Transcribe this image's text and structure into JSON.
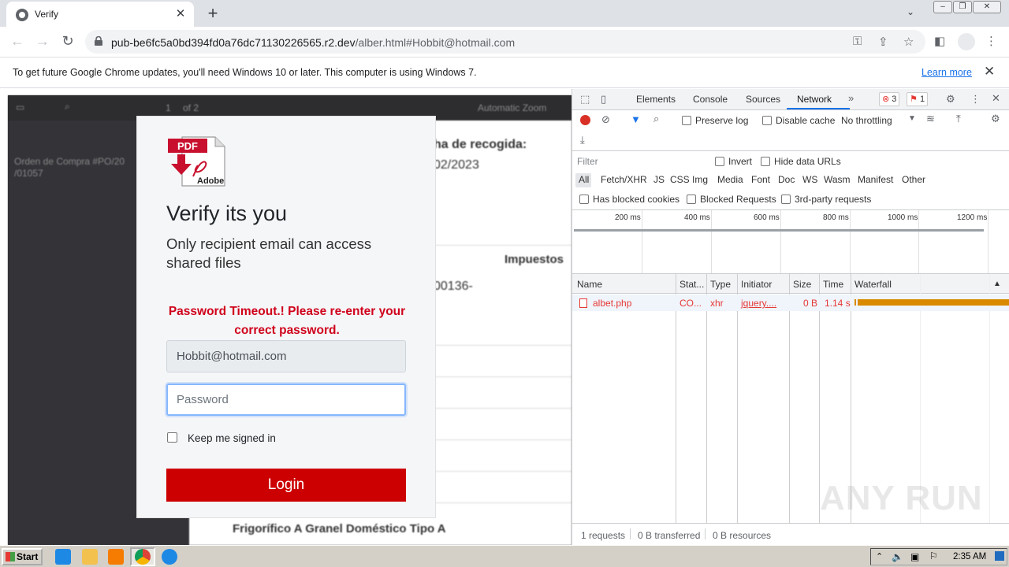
{
  "browser": {
    "tab_title": "Verify",
    "url_host": "pub-be6fc5a0bd394fd0a76dc71130226565.r2.dev",
    "url_path": "/alber.html#Hobbit@hotmail.com",
    "infobar_message": "To get future Google Chrome updates, you'll need Windows 10 or later. This computer is using Windows 7.",
    "infobar_link": "Learn more"
  },
  "pdf_background": {
    "sidebar_text_1": "Orden de Compra #PO/20",
    "sidebar_text_2": "/01057",
    "toolbar_page": "1",
    "toolbar_of": "of 2",
    "toolbar_zoom": "Automatic Zoom",
    "doc_text_1": "ha de recogida:",
    "doc_text_2": "02/2023",
    "doc_text_3": "Impuestos",
    "doc_text_4": "00136-",
    "doc_text_5": "Frigorífico A Granel Doméstico Tipo A"
  },
  "modal": {
    "logo_pdf": "PDF",
    "logo_brand": "Adobe",
    "title": "Verify its you",
    "subtitle": "Only recipient email can access shared files",
    "error": "Password Timeout.! Please re-enter your correct password.",
    "email_value": "Hobbit@hotmail.com",
    "password_placeholder": "Password",
    "keep_signed_in": "Keep me signed in",
    "login_label": "Login"
  },
  "devtools": {
    "tabs": [
      "Elements",
      "Console",
      "Sources",
      "Network"
    ],
    "active_tab": "Network",
    "error_count": "3",
    "issue_count": "1",
    "preserve_log": "Preserve log",
    "disable_cache": "Disable cache",
    "throttling": "No throttling",
    "filter_placeholder": "Filter",
    "invert": "Invert",
    "hide_data_urls": "Hide data URLs",
    "type_filters": [
      "All",
      "Fetch/XHR",
      "JS",
      "CSS",
      "Img",
      "Media",
      "Font",
      "Doc",
      "WS",
      "Wasm",
      "Manifest",
      "Other"
    ],
    "has_blocked_cookies": "Has blocked cookies",
    "blocked_requests": "Blocked Requests",
    "third_party": "3rd-party requests",
    "timeline_ticks": [
      "200 ms",
      "400 ms",
      "600 ms",
      "800 ms",
      "1000 ms",
      "1200 ms"
    ],
    "columns": [
      "Name",
      "Stat...",
      "Type",
      "Initiator",
      "Size",
      "Time",
      "Waterfall"
    ],
    "request": {
      "name": "albet.php",
      "status": "CO...",
      "type": "xhr",
      "initiator": "jquery....",
      "size": "0 B",
      "time": "1.14 s"
    },
    "status_requests": "1 requests",
    "status_transferred": "0 B transferred",
    "status_resources": "0 B resources"
  },
  "taskbar": {
    "start_label": "Start",
    "clock": "2:35 AM"
  },
  "watermark": "ANY RUN",
  "colors": {
    "login_button": "#cc0000",
    "error_text": "#d0021b",
    "devtools_accent": "#1a73e8",
    "waterfall_bar": "#d98a00"
  }
}
